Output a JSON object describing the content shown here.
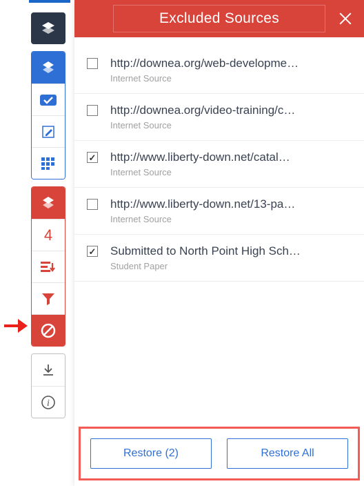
{
  "colors": {
    "blue": "#2e6fd6",
    "red": "#d8433a",
    "dark": "#2b3649"
  },
  "panel": {
    "title": "Excluded Sources",
    "footer": {
      "restore_label": "Restore (2)",
      "restore_all_label": "Restore All"
    }
  },
  "sidebar": {
    "red_group": {
      "count": "4"
    }
  },
  "sources": [
    {
      "checked": false,
      "url": "http://downea.org/web-developme…",
      "type": "Internet Source"
    },
    {
      "checked": false,
      "url": "http://downea.org/video-training/c…",
      "type": "Internet Source"
    },
    {
      "checked": true,
      "url": "http://www.liberty-down.net/catal…",
      "type": "Internet Source"
    },
    {
      "checked": false,
      "url": "http://www.liberty-down.net/13-pa…",
      "type": "Internet Source"
    },
    {
      "checked": true,
      "url": "Submitted to North Point High Sch…",
      "type": "Student Paper"
    }
  ]
}
